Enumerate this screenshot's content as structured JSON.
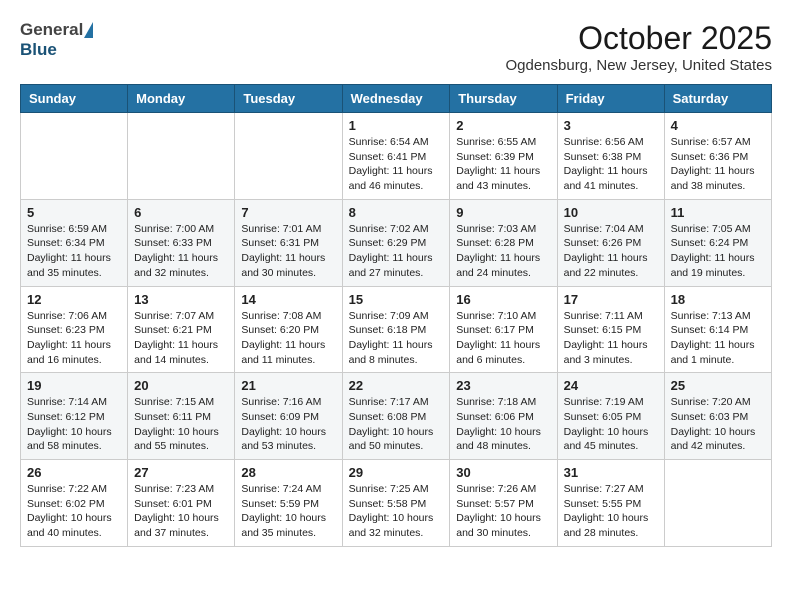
{
  "header": {
    "logo_general": "General",
    "logo_blue": "Blue",
    "month": "October 2025",
    "location": "Ogdensburg, New Jersey, United States"
  },
  "weekdays": [
    "Sunday",
    "Monday",
    "Tuesday",
    "Wednesday",
    "Thursday",
    "Friday",
    "Saturday"
  ],
  "weeks": [
    [
      {
        "day": "",
        "info": ""
      },
      {
        "day": "",
        "info": ""
      },
      {
        "day": "",
        "info": ""
      },
      {
        "day": "1",
        "info": "Sunrise: 6:54 AM\nSunset: 6:41 PM\nDaylight: 11 hours and 46 minutes."
      },
      {
        "day": "2",
        "info": "Sunrise: 6:55 AM\nSunset: 6:39 PM\nDaylight: 11 hours and 43 minutes."
      },
      {
        "day": "3",
        "info": "Sunrise: 6:56 AM\nSunset: 6:38 PM\nDaylight: 11 hours and 41 minutes."
      },
      {
        "day": "4",
        "info": "Sunrise: 6:57 AM\nSunset: 6:36 PM\nDaylight: 11 hours and 38 minutes."
      }
    ],
    [
      {
        "day": "5",
        "info": "Sunrise: 6:59 AM\nSunset: 6:34 PM\nDaylight: 11 hours and 35 minutes."
      },
      {
        "day": "6",
        "info": "Sunrise: 7:00 AM\nSunset: 6:33 PM\nDaylight: 11 hours and 32 minutes."
      },
      {
        "day": "7",
        "info": "Sunrise: 7:01 AM\nSunset: 6:31 PM\nDaylight: 11 hours and 30 minutes."
      },
      {
        "day": "8",
        "info": "Sunrise: 7:02 AM\nSunset: 6:29 PM\nDaylight: 11 hours and 27 minutes."
      },
      {
        "day": "9",
        "info": "Sunrise: 7:03 AM\nSunset: 6:28 PM\nDaylight: 11 hours and 24 minutes."
      },
      {
        "day": "10",
        "info": "Sunrise: 7:04 AM\nSunset: 6:26 PM\nDaylight: 11 hours and 22 minutes."
      },
      {
        "day": "11",
        "info": "Sunrise: 7:05 AM\nSunset: 6:24 PM\nDaylight: 11 hours and 19 minutes."
      }
    ],
    [
      {
        "day": "12",
        "info": "Sunrise: 7:06 AM\nSunset: 6:23 PM\nDaylight: 11 hours and 16 minutes."
      },
      {
        "day": "13",
        "info": "Sunrise: 7:07 AM\nSunset: 6:21 PM\nDaylight: 11 hours and 14 minutes."
      },
      {
        "day": "14",
        "info": "Sunrise: 7:08 AM\nSunset: 6:20 PM\nDaylight: 11 hours and 11 minutes."
      },
      {
        "day": "15",
        "info": "Sunrise: 7:09 AM\nSunset: 6:18 PM\nDaylight: 11 hours and 8 minutes."
      },
      {
        "day": "16",
        "info": "Sunrise: 7:10 AM\nSunset: 6:17 PM\nDaylight: 11 hours and 6 minutes."
      },
      {
        "day": "17",
        "info": "Sunrise: 7:11 AM\nSunset: 6:15 PM\nDaylight: 11 hours and 3 minutes."
      },
      {
        "day": "18",
        "info": "Sunrise: 7:13 AM\nSunset: 6:14 PM\nDaylight: 11 hours and 1 minute."
      }
    ],
    [
      {
        "day": "19",
        "info": "Sunrise: 7:14 AM\nSunset: 6:12 PM\nDaylight: 10 hours and 58 minutes."
      },
      {
        "day": "20",
        "info": "Sunrise: 7:15 AM\nSunset: 6:11 PM\nDaylight: 10 hours and 55 minutes."
      },
      {
        "day": "21",
        "info": "Sunrise: 7:16 AM\nSunset: 6:09 PM\nDaylight: 10 hours and 53 minutes."
      },
      {
        "day": "22",
        "info": "Sunrise: 7:17 AM\nSunset: 6:08 PM\nDaylight: 10 hours and 50 minutes."
      },
      {
        "day": "23",
        "info": "Sunrise: 7:18 AM\nSunset: 6:06 PM\nDaylight: 10 hours and 48 minutes."
      },
      {
        "day": "24",
        "info": "Sunrise: 7:19 AM\nSunset: 6:05 PM\nDaylight: 10 hours and 45 minutes."
      },
      {
        "day": "25",
        "info": "Sunrise: 7:20 AM\nSunset: 6:03 PM\nDaylight: 10 hours and 42 minutes."
      }
    ],
    [
      {
        "day": "26",
        "info": "Sunrise: 7:22 AM\nSunset: 6:02 PM\nDaylight: 10 hours and 40 minutes."
      },
      {
        "day": "27",
        "info": "Sunrise: 7:23 AM\nSunset: 6:01 PM\nDaylight: 10 hours and 37 minutes."
      },
      {
        "day": "28",
        "info": "Sunrise: 7:24 AM\nSunset: 5:59 PM\nDaylight: 10 hours and 35 minutes."
      },
      {
        "day": "29",
        "info": "Sunrise: 7:25 AM\nSunset: 5:58 PM\nDaylight: 10 hours and 32 minutes."
      },
      {
        "day": "30",
        "info": "Sunrise: 7:26 AM\nSunset: 5:57 PM\nDaylight: 10 hours and 30 minutes."
      },
      {
        "day": "31",
        "info": "Sunrise: 7:27 AM\nSunset: 5:55 PM\nDaylight: 10 hours and 28 minutes."
      },
      {
        "day": "",
        "info": ""
      }
    ]
  ]
}
